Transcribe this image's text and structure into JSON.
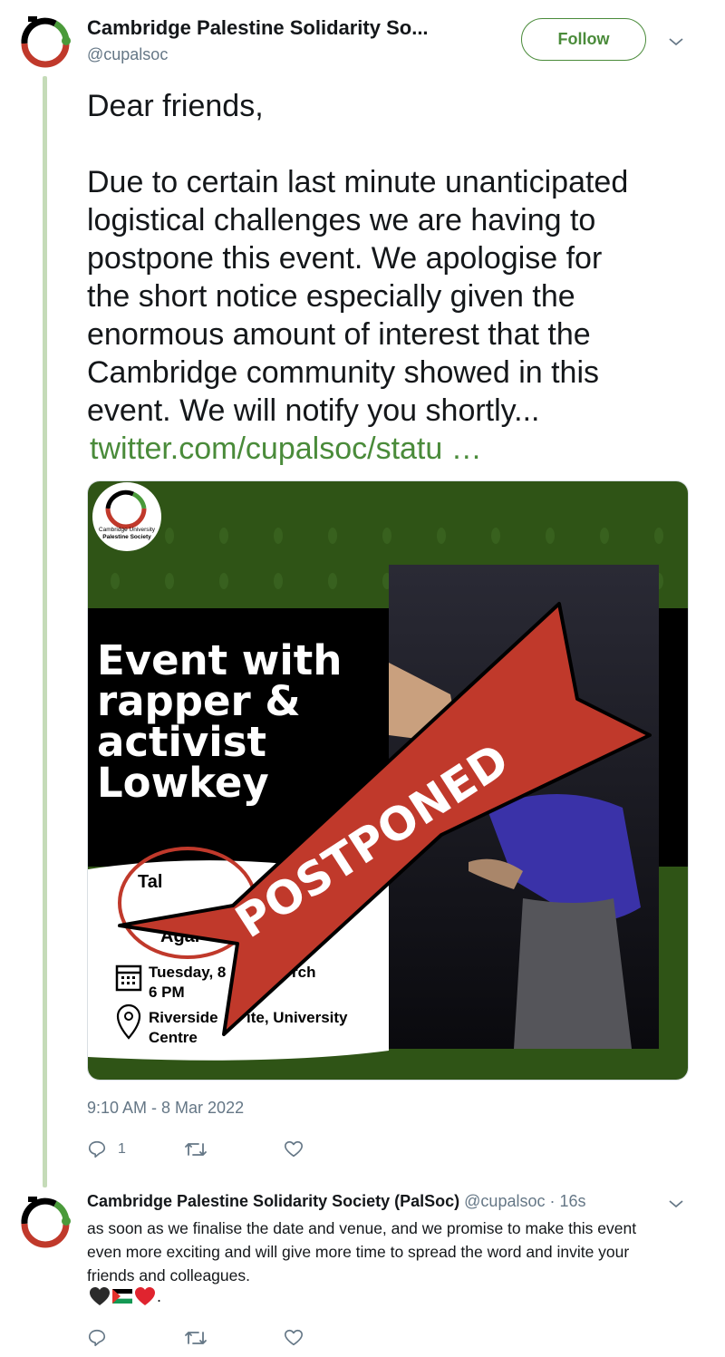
{
  "tweet": {
    "author_name": "Cambridge Palestine Solidarity So...",
    "author_handle": "@cupalsoc",
    "follow_label": "Follow",
    "text_lines": [
      "Dear friends,",
      "",
      "Due to certain last minute unanticipated",
      "logistical challenges we are having to",
      "postpone this event. We apologise for",
      "the short notice especially given the",
      "enormous amount of interest that the",
      "Cambridge community showed in this",
      "event. We will notify you shortly..."
    ],
    "link": "twitter.com/cupalsoc/statu …",
    "timestamp": "9:10 AM - 8 Mar 2022",
    "reply_count": "1"
  },
  "poster": {
    "logo_line1": "Cambridge University",
    "logo_line2": "Palestine Society",
    "headline": [
      "Event with",
      "rapper &",
      "activist",
      "Lowkey"
    ],
    "talk_partial": "Tal",
    "again_partial": "Agai",
    "date_part1": "Tuesday, 8",
    "date_part2": "rch",
    "time": "6 PM",
    "venue_part1": "Riverside",
    "venue_part2": "ite, University",
    "venue_line2": "Centre",
    "banner": "POSTPONED",
    "colors": {
      "green": "#2f5416",
      "black": "#000000",
      "red": "#c0392b"
    }
  },
  "reply": {
    "author_name": "Cambridge Palestine Solidarity Society (PalSoc)",
    "meta": "@cupalsoc · 16s",
    "text_lines": [
      "as soon as we finalise the date and venue, and we promise to make this event",
      "even more exciting and will give more time to spread the word and invite your",
      "friends and colleagues."
    ],
    "emoji_suffix": "."
  },
  "colors": {
    "accent": "#4a8b3a",
    "muted": "#657786",
    "thread": "#c5dbb8"
  }
}
